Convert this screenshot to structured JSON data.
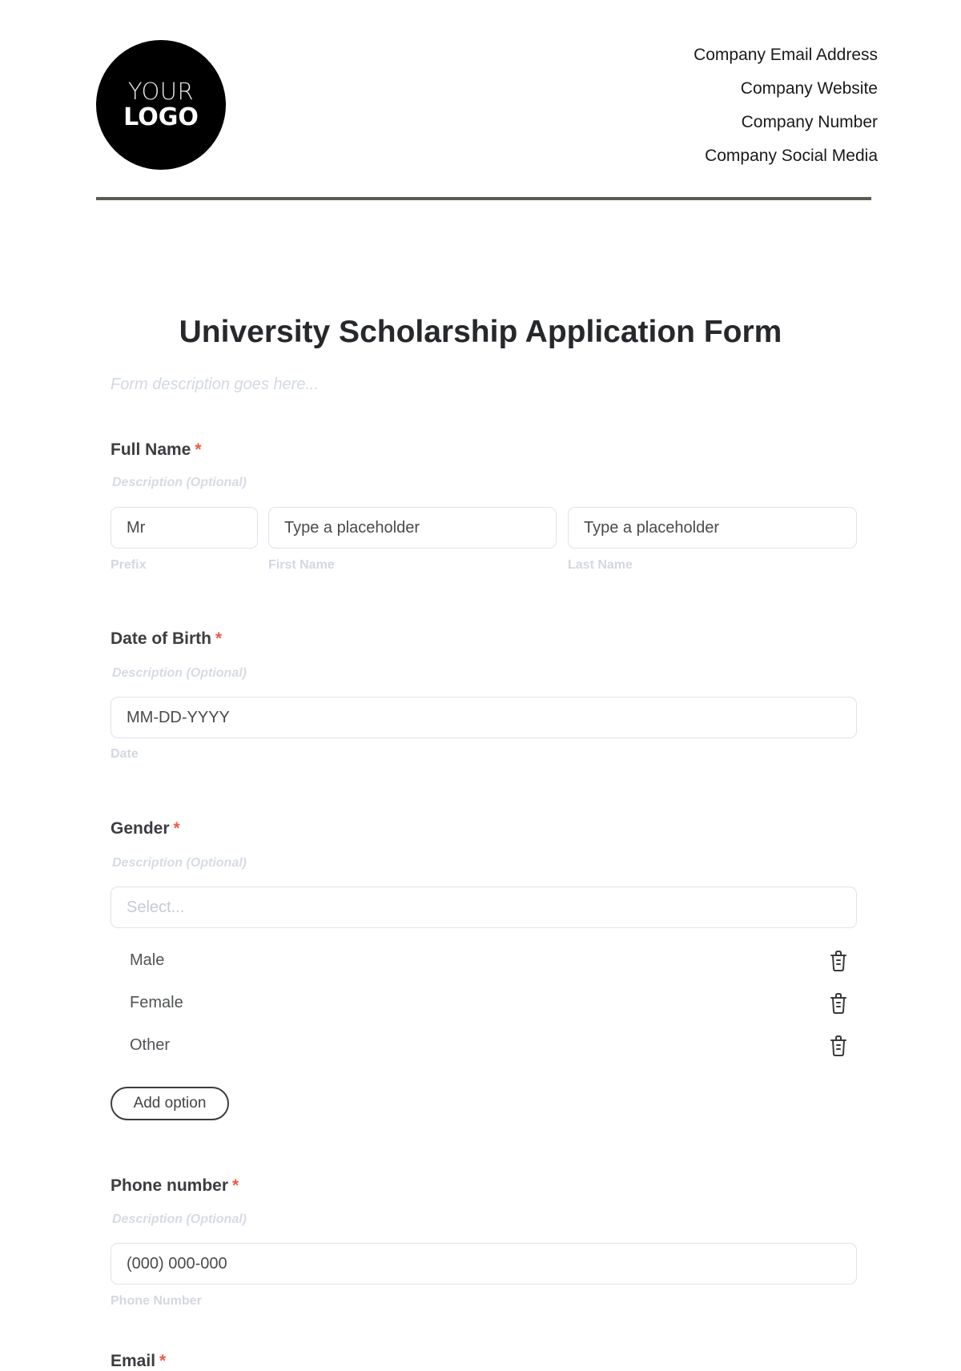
{
  "header": {
    "logo": {
      "line1": "YOUR",
      "line2": "LOGO"
    },
    "contact": [
      "Company Email Address",
      "Company Website",
      "Company Number",
      "Company Social Media"
    ]
  },
  "form": {
    "title": "University Scholarship Application Form",
    "description_placeholder": "Form description goes here...",
    "required_marker": "*",
    "fields": {
      "full_name": {
        "label": "Full Name",
        "description": "Description (Optional)",
        "prefix": {
          "value": "Mr",
          "sublabel": "Prefix"
        },
        "first_name": {
          "placeholder": "Type a placeholder",
          "sublabel": "First Name"
        },
        "last_name": {
          "placeholder": "Type a placeholder",
          "sublabel": "Last Name"
        }
      },
      "date_of_birth": {
        "label": "Date of Birth",
        "description": "Description (Optional)",
        "placeholder": "MM-DD-YYYY",
        "sublabel": "Date"
      },
      "gender": {
        "label": "Gender",
        "description": "Description (Optional)",
        "placeholder": "Select...",
        "options": [
          "Male",
          "Female",
          "Other"
        ],
        "add_option_label": "Add option"
      },
      "phone": {
        "label": "Phone number",
        "description": "Description (Optional)",
        "placeholder": "(000) 000-000",
        "sublabel": "Phone Number"
      },
      "email": {
        "label": "Email"
      }
    }
  }
}
